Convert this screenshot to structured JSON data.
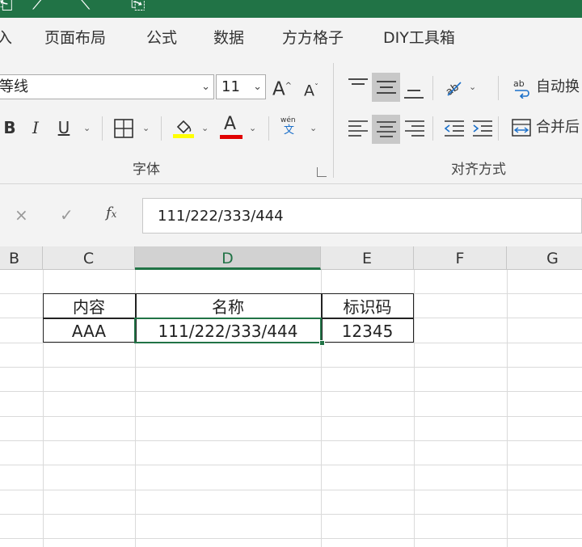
{
  "tabs": [
    "入",
    "页面布局",
    "公式",
    "数据",
    "方方格子",
    "DIY工具箱"
  ],
  "font_group": {
    "font_name": "等线",
    "font_size": "11",
    "grow_icon": "A",
    "shrink_icon": "A",
    "bold": "B",
    "italic": "I",
    "underline": "U",
    "font_color_icon": "A",
    "phonetic_top": "wén",
    "phonetic_bottom": "文",
    "label": "字体"
  },
  "align_group": {
    "wrap_text": "自动换",
    "merge_center": "合并后",
    "label": "对齐方式"
  },
  "colors": {
    "excel_green": "#217346",
    "highlight_yellow": "#ffff00",
    "font_red": "#e00000"
  },
  "formula_bar": {
    "cancel": "×",
    "enter": "✓",
    "value": "111/222/333/444"
  },
  "columns": [
    "B",
    "C",
    "D",
    "E",
    "F",
    "G"
  ],
  "table": {
    "headers": [
      "内容",
      "名称",
      "标识码"
    ],
    "row": [
      "AAA",
      "111/222/333/444",
      "12345"
    ]
  }
}
